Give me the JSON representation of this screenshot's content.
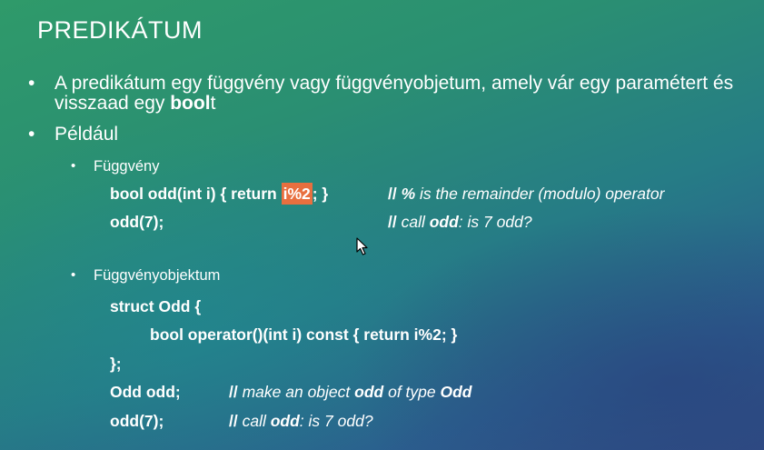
{
  "title": "PREDIKÁTUM",
  "bullets": {
    "b1_pre": "A predikátum egy függvény vagy függvényobjetum, amely vár egy paramétert és visszaad egy ",
    "b1_bold": "bool",
    "b1_post": "t",
    "b2": "Például",
    "sub1": "Függvény",
    "sub2": "Függvényobjektum",
    "dot": "•"
  },
  "example1": {
    "line1_a": "bool odd(int i) { return ",
    "line1_hl": "i%2",
    "line1_b": "; }",
    "line1_comment_slashes": "// ",
    "line1_comment_bold": "%",
    "line1_comment_rest": " is the remainder (modulo) operator",
    "line2": "odd(7);",
    "line2_comment_slashes": "// ",
    "line2_comment_a": "call ",
    "line2_comment_bold": "odd",
    "line2_comment_b": ": is 7 odd?"
  },
  "example2": {
    "line1": "struct Odd {",
    "line2": "bool operator()(int i) const { return i%2; }",
    "line3": "};",
    "line4": "Odd odd;",
    "line4_comment_slashes": "// ",
    "line4_comment_a": "make an object ",
    "line4_comment_bold1": "odd",
    "line4_comment_b": " of type ",
    "line4_comment_bold2": "Odd",
    "line5": "odd(7);",
    "line5_comment_slashes": "// ",
    "line5_comment_a": "call ",
    "line5_comment_bold": "odd",
    "line5_comment_b": ": is 7 odd?"
  },
  "colors": {
    "highlight": "#e86f3f",
    "text": "#ffffff"
  },
  "icons": {
    "cursor": "mouse-pointer-icon"
  }
}
